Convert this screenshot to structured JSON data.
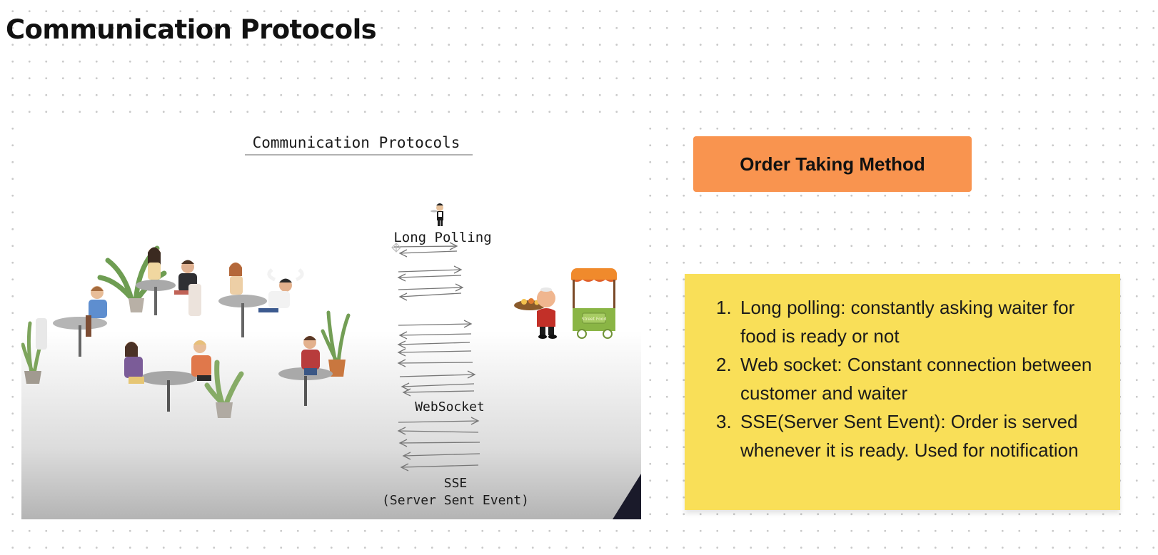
{
  "board": {
    "title": "Communication Protocols"
  },
  "slide": {
    "heading": "Communication Protocols",
    "labels": {
      "long_polling": "Long Polling",
      "websocket": "WebSocket",
      "sse_line1": "SSE",
      "sse_line2": "(Server Sent Event)"
    },
    "cart_sign": "Street Food"
  },
  "order_method": {
    "label": "Order Taking Method",
    "color": "#f9944f"
  },
  "notes": {
    "color": "#f9df58",
    "items": [
      {
        "num": "1.",
        "text": "Long polling: constantly asking waiter for food is ready or not"
      },
      {
        "num": "2.",
        "text": "Web socket: Constant connection between customer and waiter"
      },
      {
        "num": "3.",
        "text": "SSE(Server Sent Event): Order is served whenever it is ready. Used for notification"
      }
    ]
  }
}
